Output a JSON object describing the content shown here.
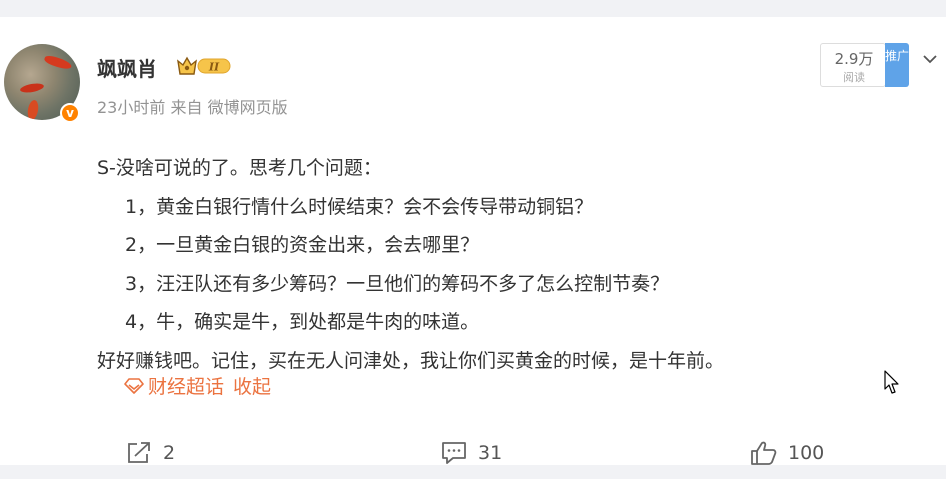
{
  "user": {
    "name": "飒飒肖",
    "level_badge": "II",
    "verified_icon": "v",
    "time": "23小时前",
    "from_prefix": "来自",
    "source": "微博网页版"
  },
  "stats": {
    "reads": "2.9万",
    "reads_label": "阅读",
    "push_label": "推广"
  },
  "post": {
    "lines": [
      "S-没啥可说的了。思考几个问题：",
      "1，黄金白银行情什么时候结束？会不会传导带动铜铝？",
      "2，一旦黄金白银的资金出来，会去哪里？",
      "3，汪汪队还有多少筹码？一旦他们的筹码不多了怎么控制节奏？",
      "4，牛，确实是牛，到处都是牛肉的味道。",
      "好好赚钱吧。记住，买在无人问津处，我让你们买黄金的时候，是十年前。"
    ],
    "topic": "财经超话",
    "collapse": "收起"
  },
  "actions": {
    "forward_count": "2",
    "comment_count": "31",
    "like_count": "100"
  },
  "colors": {
    "accent_orange": "#eb7340",
    "verify_orange": "#ff8200",
    "push_blue": "#5fa3e8"
  }
}
